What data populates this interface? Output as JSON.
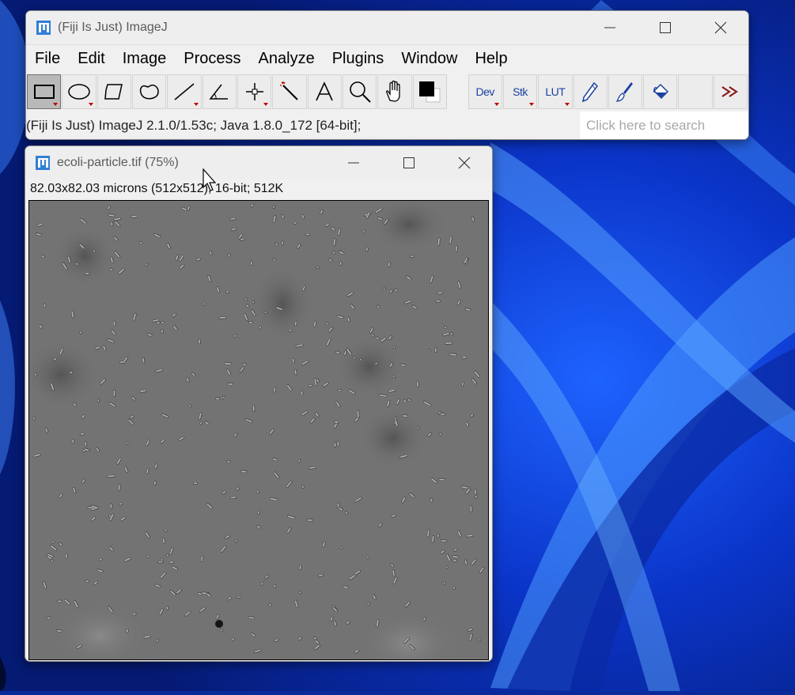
{
  "colors": {
    "desktop_base": "#0b2fb0",
    "micrograph_bg": "#737373"
  },
  "imagej": {
    "title": "(Fiji Is Just) ImageJ",
    "menu": [
      "File",
      "Edit",
      "Image",
      "Process",
      "Analyze",
      "Plugins",
      "Window",
      "Help"
    ],
    "tools": [
      {
        "name": "rectangle-tool",
        "icon": "rectangle-icon",
        "selected": true
      },
      {
        "name": "oval-tool",
        "icon": "oval-icon"
      },
      {
        "name": "polygon-tool",
        "icon": "polygon-icon"
      },
      {
        "name": "freehand-tool",
        "icon": "freehand-icon"
      },
      {
        "name": "line-tool",
        "icon": "line-icon"
      },
      {
        "name": "angle-tool",
        "icon": "angle-icon"
      },
      {
        "name": "point-tool",
        "icon": "crosshair-icon"
      },
      {
        "name": "wand-tool",
        "icon": "wand-icon"
      },
      {
        "name": "text-tool",
        "icon": "text-icon"
      },
      {
        "name": "magnifier-tool",
        "icon": "magnifier-icon"
      },
      {
        "name": "scroll-tool",
        "icon": "hand-icon"
      },
      {
        "name": "color-picker-tool",
        "icon": "color-picker-icon"
      }
    ],
    "extra_tools": {
      "dev": "Dev",
      "stk": "Stk",
      "lut": "LUT"
    },
    "status": "(Fiji Is Just) ImageJ 2.1.0/1.53c; Java 1.8.0_172 [64-bit];",
    "search_placeholder": "Click here to search"
  },
  "image_window": {
    "title": "ecoli-particle.tif (75%)",
    "info": "82.03x82.03 microns (512x512); 16-bit; 512K"
  }
}
